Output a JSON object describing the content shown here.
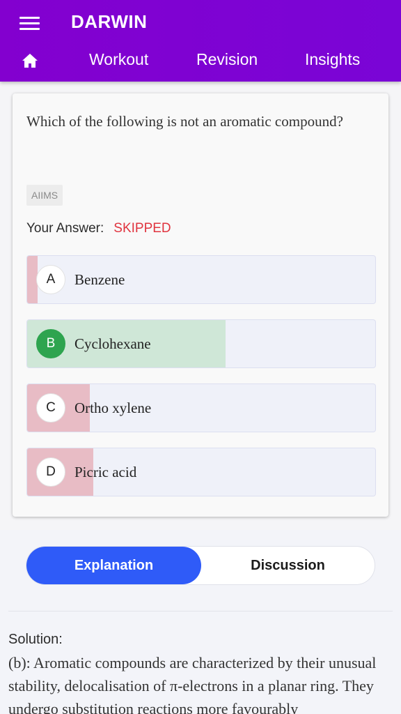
{
  "header": {
    "app_title": "DARWIN",
    "nav": [
      "Workout",
      "Revision",
      "Insights"
    ]
  },
  "question": {
    "text": "Which of the following is not an aromatic compound?",
    "tag": "AIIMS",
    "your_answer_label": "Your Answer:",
    "your_answer_value": "SKIPPED",
    "options": [
      {
        "letter": "A",
        "text": "Benzene",
        "response_share": 0.03,
        "correct": false
      },
      {
        "letter": "B",
        "text": "Cyclohexane",
        "response_share": 0.57,
        "correct": true
      },
      {
        "letter": "C",
        "text": "Ortho xylene",
        "response_share": 0.18,
        "correct": false
      },
      {
        "letter": "D",
        "text": "Picric acid",
        "response_share": 0.19,
        "correct": false
      }
    ]
  },
  "tabs": {
    "explanation": "Explanation",
    "discussion": "Discussion"
  },
  "solution": {
    "title": "Solution:",
    "text": "(b): Aromatic compounds are characterized by their unusual stability, delocalisation of π-electrons in a planar ring. They undergo substitution reactions more favourably"
  },
  "colors": {
    "header": "#8300cf",
    "active_tab": "#2f5bf8",
    "skipped": "#e0343f",
    "correct": "#2ea44f",
    "wrong_fill": "#e8bcc5",
    "correct_fill": "#cfe7d7"
  }
}
